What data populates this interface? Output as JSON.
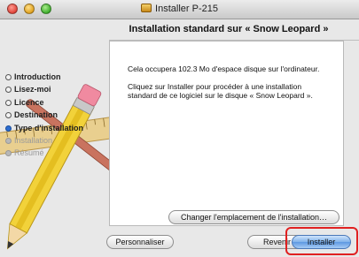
{
  "window": {
    "title": "Installer P-215"
  },
  "header": {
    "subtitle": "Installation standard sur « Snow Leopard »"
  },
  "sidebar": {
    "steps": [
      {
        "label": "Introduction",
        "state": "done"
      },
      {
        "label": "Lisez-moi",
        "state": "done"
      },
      {
        "label": "Licence",
        "state": "done"
      },
      {
        "label": "Destination",
        "state": "done"
      },
      {
        "label": "Type d'installation",
        "state": "current"
      },
      {
        "label": "Installation",
        "state": "future"
      },
      {
        "label": "Résumé",
        "state": "future"
      }
    ]
  },
  "content": {
    "paragraph1": "Cela occupera 102.3 Mo d'espace disque sur l'ordinateur.",
    "paragraph2": "Cliquez sur Installer pour procéder à une installation standard de ce logiciel sur le disque « Snow Leopard »."
  },
  "buttons": {
    "change_location": "Changer l'emplacement de l'installation…",
    "customize": "Personnaliser",
    "back": "Revenir",
    "install": "Installer"
  },
  "colors": {
    "highlight": "#e02121",
    "current_step": "#2c6ccf"
  }
}
